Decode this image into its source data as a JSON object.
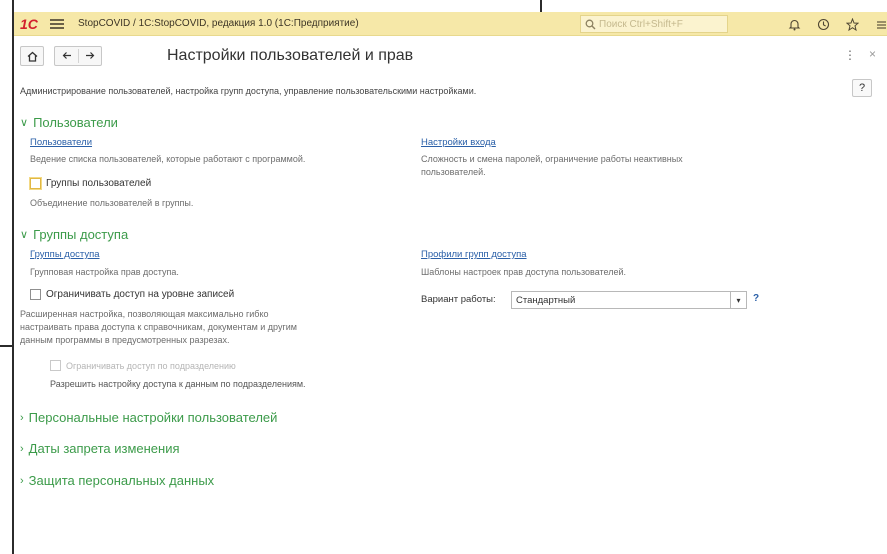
{
  "titlebar": {
    "logo": "1С",
    "title": "StopCOVID / 1С:StopCOVID, редакция 1.0  (1С:Предприятие)",
    "search_placeholder": "Поиск Ctrl+Shift+F",
    "icons": [
      "bell-icon",
      "history-icon",
      "star-icon",
      "menu-more-icon"
    ]
  },
  "header": {
    "home_icon": "home-icon",
    "back_icon": "arrow-left-icon",
    "forward_icon": "arrow-right-icon",
    "title": "Настройки пользователей и прав",
    "more_label": "⋮",
    "close_label": "×"
  },
  "description": "Администрирование пользователей, настройка групп доступа, управление пользовательскими настройками.",
  "help_label": "?",
  "sections": {
    "users": {
      "title": "Пользователи",
      "users_link": "Пользователи",
      "users_desc": "Ведение списка пользователей, которые работают с программой.",
      "groups_checkbox": "Группы пользователей",
      "groups_desc": "Объединение пользователей в группы.",
      "login_link": "Настройки входа",
      "login_desc_1": "Сложность и смена паролей, ограничение работы неактивных",
      "login_desc_2": "пользователей."
    },
    "access": {
      "title": "Группы доступа",
      "groups_link": "Группы доступа",
      "groups_desc": "Групповая настройка прав доступа.",
      "restrict_checkbox": "Ограничивать доступ на уровне записей",
      "restrict_desc_1": "Расширенная настройка, позволяющая максимально гибко",
      "restrict_desc_2": "настраивать права доступа к справочникам, документам и другим",
      "restrict_desc_3": "данным программы в предусмотренных разрезах.",
      "subdivision_checkbox": "Ограничивать доступ по подразделению",
      "subdivision_desc": "Разрешить настройку доступа к данным по подразделениям.",
      "profiles_link": "Профили групп доступа",
      "profiles_desc": "Шаблоны настроек прав доступа пользователей.",
      "mode_label": "Вариант работы:",
      "mode_value": "Стандартный",
      "mode_help": "?"
    },
    "personal": {
      "title": "Персональные настройки пользователей"
    },
    "dates": {
      "title": "Даты запрета изменения"
    },
    "data": {
      "title": "Защита персональных данных"
    }
  },
  "colors": {
    "titlebar_bg": "#f6e8a8",
    "section_green": "#3c9b4a",
    "link_blue": "#2b60a8",
    "logo_red": "#d3202e"
  }
}
